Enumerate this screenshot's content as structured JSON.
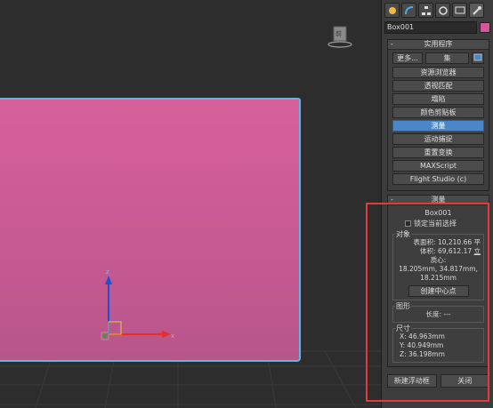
{
  "viewport": {
    "viewcube_label": "前"
  },
  "panel": {
    "tabs": [
      "create-icon",
      "modify-icon",
      "hierarchy-icon",
      "motion-icon",
      "display-icon",
      "utilities-icon"
    ],
    "object_name": "Box001",
    "object_color": "#d6559b",
    "utilities": {
      "title": "实用程序",
      "more_label": "更多...",
      "sets_label": "集",
      "items": [
        "资源浏览器",
        "透视匹配",
        "塌陷",
        "颜色剪贴板",
        "测量",
        "运动捕捉",
        "重置变换",
        "MAXScript",
        "Flight Studio (c)"
      ],
      "active_index": 4
    },
    "measure": {
      "title": "测量",
      "object_name": "Box001",
      "lock_label": "锁定当前选择",
      "objects_group": "对象",
      "surface_area": "表面积: 10,210.66 平",
      "volume_prefix": "体积: 69,612.17 ",
      "volume_suffix": "立",
      "center_label": "质心:",
      "center_line1": "18.205mm, 34.817mm,",
      "center_line2": "18.215mm",
      "create_center_btn": "创建中心点",
      "shapes_group": "图形",
      "length": "长度: ---",
      "dimensions_group": "尺寸",
      "dim_x": "X:   46.963mm",
      "dim_y": "Y:   40.949mm",
      "dim_z": "Z:   36.198mm",
      "new_floater_btn": "新建浮动框",
      "close_btn": "关闭"
    }
  }
}
